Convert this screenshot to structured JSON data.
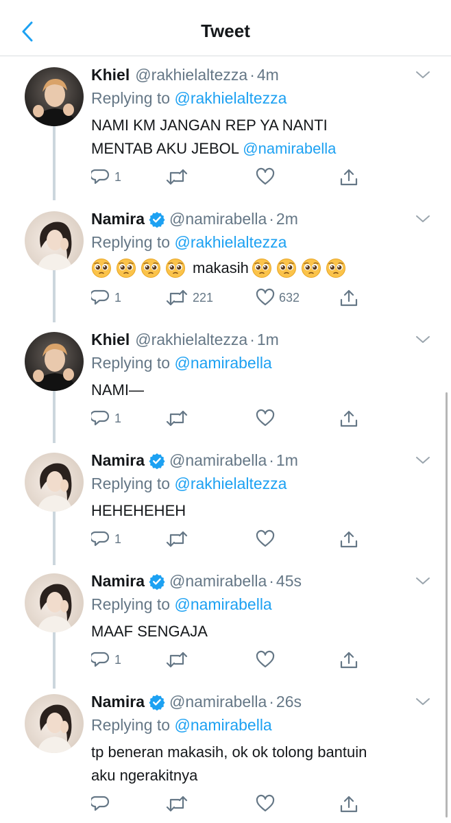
{
  "header": {
    "title": "Tweet",
    "back_icon": "chevron-left-icon"
  },
  "colors": {
    "link": "#1da1f2",
    "muted": "#657786",
    "text": "#14171a",
    "verified": "#1da1f2"
  },
  "tweets": [
    {
      "name": "Khiel",
      "verified": false,
      "handle": "@rakhielaltezza",
      "time": "4m",
      "replying_label": "Replying to",
      "replying_to": "@rakhielaltezza",
      "text_line1": "NAMI KM JANGAN REP YA NANTI",
      "text_line2": "MENTAB AKU JEBOL",
      "text_mention": "@namirabella",
      "replies": "1",
      "retweets": "",
      "likes": ""
    },
    {
      "name": "Namira",
      "verified": true,
      "handle": "@namirabella",
      "time": "2m",
      "replying_label": "Replying to",
      "replying_to": "@rakhielaltezza",
      "text_word": "makasih",
      "replies": "1",
      "retweets": "221",
      "likes": "632"
    },
    {
      "name": "Khiel",
      "verified": false,
      "handle": "@rakhielaltezza",
      "time": "1m",
      "replying_label": "Replying to",
      "replying_to": "@namirabella",
      "text": "NAMI—",
      "replies": "1",
      "retweets": "",
      "likes": ""
    },
    {
      "name": "Namira",
      "verified": true,
      "handle": "@namirabella",
      "time": "1m",
      "replying_label": "Replying to",
      "replying_to": "@rakhielaltezza",
      "text": "HEHEHEHEH",
      "replies": "1",
      "retweets": "",
      "likes": ""
    },
    {
      "name": "Namira",
      "verified": true,
      "handle": "@namirabella",
      "time": "45s",
      "replying_label": "Replying to",
      "replying_to": "@namirabella",
      "text": "MAAF SENGAJA",
      "replies": "1",
      "retweets": "",
      "likes": ""
    },
    {
      "name": "Namira",
      "verified": true,
      "handle": "@namirabella",
      "time": "26s",
      "replying_label": "Replying to",
      "replying_to": "@namirabella",
      "text_line1": "tp beneran makasih, ok ok tolong bantuin",
      "text_line2": "aku ngerakitnya",
      "replies": "",
      "retweets": "",
      "likes": ""
    }
  ]
}
